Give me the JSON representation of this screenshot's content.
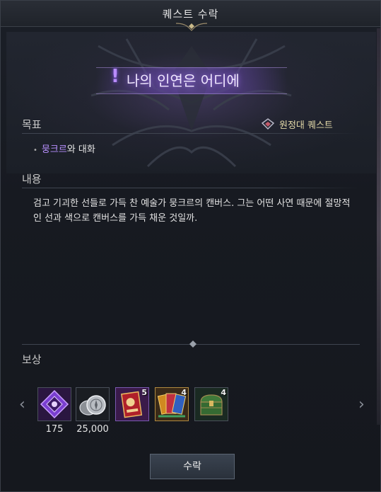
{
  "window": {
    "title": "퀘스트 수락"
  },
  "quest": {
    "mark": "!",
    "name": "나의 인연은 어디에",
    "type_label": "원정대 퀘스트"
  },
  "objective": {
    "label": "목표",
    "bullet": "•",
    "npc": "뭉크르",
    "action": "와 대화"
  },
  "content": {
    "label": "내용",
    "text": "검고 기괴한 선들로 가득 찬 예술가 뭉크르의 캔버스. 그는 어떤 사연 때문에 절망적인 선과 색으로 캔버스를 가득 채운 것일까."
  },
  "rewards": {
    "label": "보상",
    "prev_arrow": "‹",
    "next_arrow": "›",
    "items": [
      {
        "icon": "purple-crystal-icon",
        "count": "",
        "quantity": "175"
      },
      {
        "icon": "silver-coins-icon",
        "count": "",
        "quantity": "25,000"
      },
      {
        "icon": "card-icon",
        "count": "5",
        "quantity": ""
      },
      {
        "icon": "card-pack-icon",
        "count": "4",
        "quantity": ""
      },
      {
        "icon": "green-chest-icon",
        "count": "4",
        "quantity": ""
      }
    ]
  },
  "buttons": {
    "accept": "수락"
  },
  "colors": {
    "accent_purple": "#b990ff",
    "expedition_text": "#e3d9a8",
    "panel_bg": "#171a21"
  }
}
